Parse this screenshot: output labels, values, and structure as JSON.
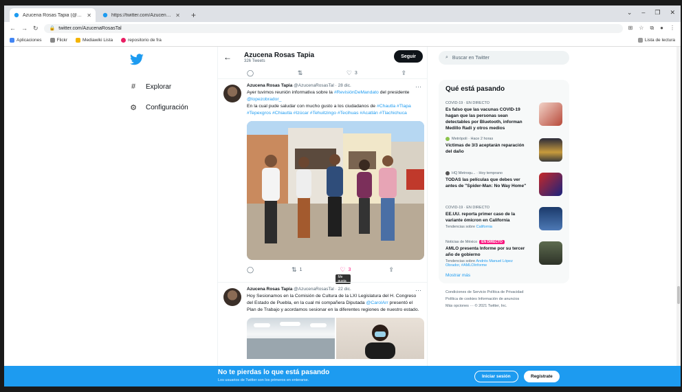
{
  "colors": {
    "twitter_blue": "#1d9bf0",
    "like_pink": "#f91880"
  },
  "browser": {
    "tabs": [
      {
        "title": "Azucena Rosas Tapia (@AzucenaRosas...",
        "active": true
      },
      {
        "title": "https://twitter.com/AzucenaRosas...",
        "active": false
      }
    ],
    "url": "twitter.com/AzucenaRosasTal",
    "bookmarks": [
      "Aplicaciones",
      "Flickr",
      "Mediawiki Lista",
      "repositorio de fra"
    ],
    "bookmarks_right": "Lista de lectura"
  },
  "nav": {
    "explore": "Explorar",
    "settings": "Configuración"
  },
  "profile_header": {
    "name": "Azucena Rosas Tapia",
    "tweets_count": "326 Tweets",
    "follow_label": "Seguir"
  },
  "top_actions": {
    "like_count": "3"
  },
  "tweet1": {
    "author": "Azucena Rosas Tapia",
    "handle": "@AzucenaRosasTal",
    "time": "28 dic.",
    "text_plain": "Ayer tuvimos reunión informativa sobre la",
    "hashtag_link": "#RevisiónDeMandato",
    "text_after": "del presidente",
    "mention": "@lopezobrador_",
    "text_2": "En la cual pude saludar con mucho gusto a los ciudadanos de",
    "hashtags": "#Chautla #Tlapa #Tepexgros #Chiautla #Izúcar #Tehuitzingo #Tecihuas #Acatlán #Tlachichuca",
    "retweets": "1",
    "likes": "3",
    "tooltip": "Me gusta"
  },
  "tweet2": {
    "author": "Azucena Rosas Tapia",
    "handle": "@AzucenaRosasTal",
    "time": "22 dic.",
    "text_1": "Hoy Sesionamos en la Comisión de Cultura de la LXI Legislatura del H. Congreso del Estado de Puebla, en la cual mi compañera Diputada",
    "mention": "@CarolArr",
    "text_2": "presentó el Plan de Trabajo y acordamos sesionar en la diferentes regiones de nuestro estado."
  },
  "search": {
    "placeholder": "Buscar en Twitter"
  },
  "trends": {
    "title": "Qué está pasando",
    "items": [
      {
        "meta": "COVID-19 · EN DIRECTO",
        "title": "Es falso que las vacunas COVID-19 hagan que las personas sean detectables por Bluetooth, informan Medillo Radi y otros medios",
        "extra": "",
        "thumb": "covid"
      },
      {
        "meta": "Metrópoli · Hace 2 horas",
        "title": "Víctimas de 3/3 aceptarán reparación del daño",
        "extra": "",
        "thumb": "night"
      },
      {
        "meta": "HQ Metroqu... · Hoy temprano",
        "title": "TODAS las películas que debes ver antes de \"Spider-Man: No Way Home\"",
        "extra": "",
        "thumb": "spider"
      },
      {
        "meta": "COVID-19 · EN DIRECTO",
        "title": "EE.UU. reporta primer caso de la variante ómicron en California",
        "extra_prefix": "Tendencias sobre",
        "extra_link": "California",
        "thumb": "lab"
      },
      {
        "meta": "Noticias de México",
        "badge": "EN DIRECTO",
        "title": "AMLO presenta Informe por su tercer año de gobierno",
        "extra_prefix": "Tendencias sobre",
        "extra_link": "Andrés Manuel López Obrador, #AMLOInforme",
        "thumb": "gov"
      }
    ],
    "show_more": "Mostrar más"
  },
  "footer": {
    "line1": "Condiciones de Servicio   Política de Privacidad",
    "line2": "Política de cookies   Información de anuncios",
    "line3": "Más opciones ···   © 2021 Twitter, Inc."
  },
  "banner": {
    "title": "No te pierdas lo que está pasando",
    "subtitle": "Los usuarios de Twitter son los primeros en enterarse.",
    "login": "Iniciar sesión",
    "signup": "Regístrate"
  }
}
